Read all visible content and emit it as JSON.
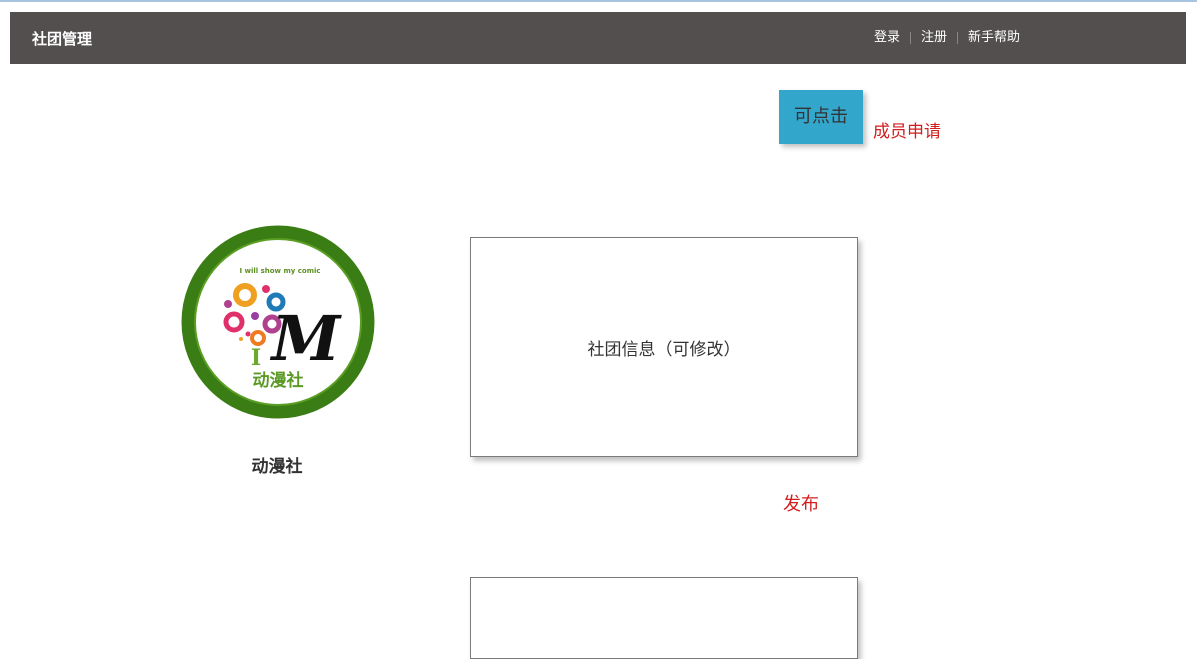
{
  "nav": {
    "brand": "社团管理",
    "links": [
      "登录",
      "注册",
      "新手帮助"
    ]
  },
  "actions": {
    "click_button": "可点击",
    "member_apply": "成员申请",
    "publish": "发布"
  },
  "club": {
    "name": "动漫社",
    "logo": {
      "slogan": "I will show my comic",
      "letter_i": "I",
      "letter_m": "M",
      "caption": "动漫社"
    }
  },
  "info_box": {
    "label": "社团信息（可修改）"
  },
  "colors": {
    "navbar": "#524f4e",
    "accent": "#33a6cc",
    "link_red": "#d21e1e",
    "logo_ring": "#3a7d14"
  }
}
